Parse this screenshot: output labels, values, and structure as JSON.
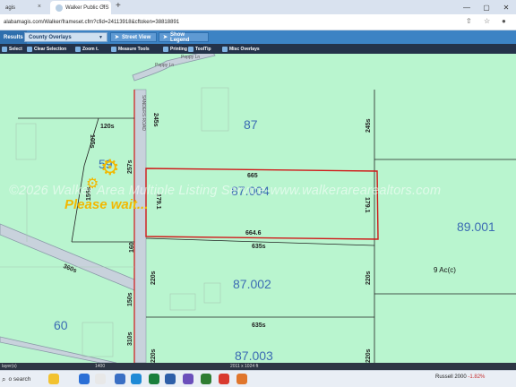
{
  "browser": {
    "tabs": [
      {
        "label": "agis"
      },
      {
        "label": "Walker Public GIS"
      }
    ],
    "new_tab": "+",
    "url": "alabamagis.com/Walker/frameset.cfm?cfid=24113918&cftoken=38818891"
  },
  "gis_toolbar": {
    "results_label": "Results",
    "overlay_select": "County Overlays",
    "street_view_label": "Street View",
    "show_legend_label": "Show Legend"
  },
  "tools": {
    "select": "Select",
    "clear_selection": "Clear Selection",
    "zoom": "Zoom t.",
    "measure": "Measure Tools",
    "printing": "Printing",
    "tooltip": "ToolTip",
    "misc_overlays": "Misc Overlays"
  },
  "map": {
    "road_name": "SANDERS ROAD",
    "road_labels": [
      "Poppy Ln",
      "Poppy Ln"
    ],
    "parcels": [
      "87",
      "87.004",
      "89.001",
      "87.002",
      "87.003",
      "60",
      "59"
    ],
    "dimensions": {
      "d120": "120s",
      "d105": "105s",
      "d155": "155s",
      "d257": "257s",
      "d245a": "245s",
      "d245b": "245s",
      "d665": "665",
      "d1791a": "179.1",
      "d1791b": "179.1",
      "d6646": "664.6",
      "d635a": "635s",
      "d220a": "220s",
      "d220b": "220s",
      "d635b": "635s",
      "d310": "310s",
      "d220c": "220s",
      "d220d": "220s",
      "d160": "160",
      "d360": "360s",
      "d150": "150s"
    },
    "acres_label": "9 Ac(c)",
    "watermark": "©2026 Walker Area Multiple Listing Service-www.walkerarearealtors.com",
    "loading_text": "Please wait..."
  },
  "status": {
    "layers": "layer(s)",
    "scale": "1400",
    "dimensions": "2011 x 1024 ft"
  },
  "taskbar": {
    "search_label": "o search",
    "ticker_name": "Russell 2000",
    "ticker_change": "-1.82%"
  },
  "colors": {
    "map_bg": "#b9f5cf",
    "selection_outline": "#d01818",
    "parcel_label": "#3c6cb3",
    "toolbar_blue": "#3c83c4"
  }
}
